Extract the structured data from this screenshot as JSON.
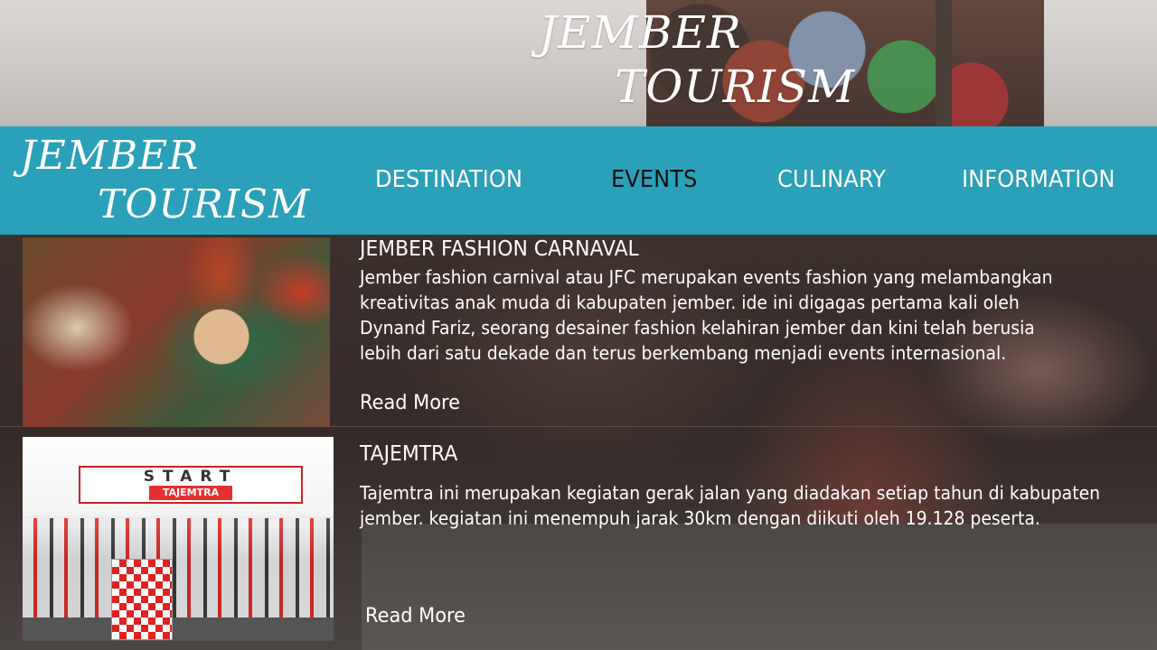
{
  "hero": {
    "title_line1": "JEMBER",
    "title_line2": "TOURISM"
  },
  "nav": {
    "logo_line1": "JEMBER",
    "logo_line2": "TOURISM",
    "items": [
      {
        "label": "DESTINATION",
        "active": false
      },
      {
        "label": "EVENTS",
        "active": true
      },
      {
        "label": "CULINARY",
        "active": false
      },
      {
        "label": "INFORMATION",
        "active": false
      }
    ]
  },
  "events": [
    {
      "title": "JEMBER FASHION CARNAVAL",
      "body_lines": [
        "Jember fashion carnival atau JFC merupakan events fashion yang melambangkan",
        "kreativitas anak muda di kabupaten jember. ide ini digagas pertama kali oleh",
        "Dynand Fariz, seorang desainer fashion kelahiran jember dan kini telah berusia",
        "lebih dari satu dekade dan terus berkembang menjadi events internasional."
      ],
      "read_more": "Read More"
    },
    {
      "title": "TAJEMTRA",
      "body_lines": [
        "Tajemtra ini merupakan kegiatan gerak jalan yang diadakan setiap tahun di kabupaten",
        "jember. kegiatan ini menempuh jarak 30km dengan diikuti oleh 19.128 peserta."
      ],
      "read_more": "Read More",
      "photo_banner": "START",
      "photo_banner_sub": "TAJEMTRA"
    }
  ],
  "colors": {
    "nav_bar": "#2aa0b9",
    "nav_active": "#111111"
  }
}
